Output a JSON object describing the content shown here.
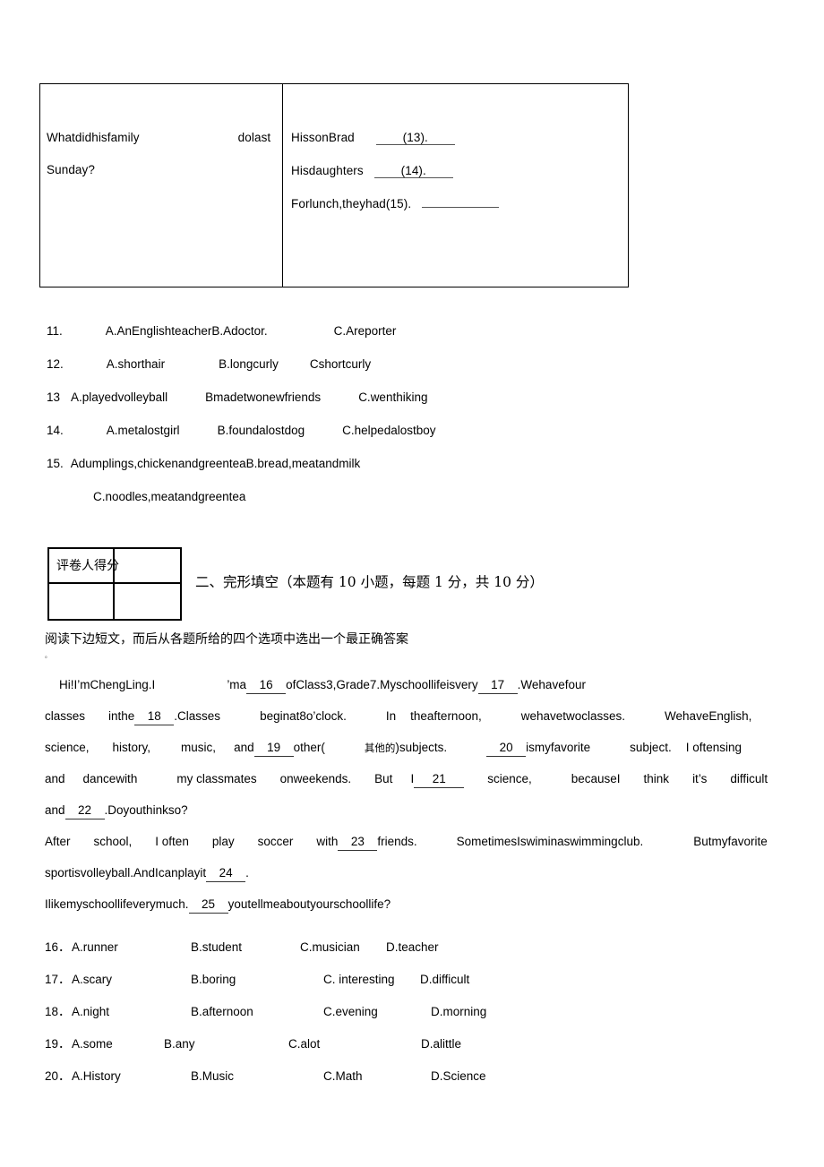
{
  "document": {
    "type": "exam-paper",
    "language": "en-zh"
  },
  "top_table": {
    "left_cell": {
      "line1_a": "Whatdidhisfamily",
      "line1_b": "dolast",
      "line2": "Sunday?"
    },
    "right_cell": {
      "row1_label": "HissonBrad",
      "row1_blank": "(13).",
      "row2_label": "Hisdaughters",
      "row2_blank": "(14).",
      "row3_label": "Forlunch,theyhad(15).",
      "row3_blank": ""
    }
  },
  "choices_a": [
    {
      "num": "11.",
      "a": "A.AnEnglishteacher",
      "b": "B.Adoctor.",
      "c": "C.Areporter",
      "d": ""
    },
    {
      "num": "12.",
      "a": "A.shorthair",
      "b": "B.longcurly",
      "c": "Cshortcurly",
      "d": ""
    },
    {
      "num": "13",
      "a": "A.playedvolleyball",
      "b": "Bmadetwonewfriends",
      "c": "C.wenthiking",
      "d": ""
    },
    {
      "num": "14.",
      "a": "A.metalostgirl",
      "b": "B.foundalostdog",
      "c": "C.helpedalostboy",
      "d": ""
    },
    {
      "num": "15.",
      "a": "Adumplings,chickenandgreentea",
      "b": "B.bread,meatandmilk",
      "c": "C.noodles,meatandgreentea",
      "d": ""
    }
  ],
  "score_box": {
    "label": "评卷人得分"
  },
  "section": {
    "heading": "二、完形填空（本题有 10 小题，每题 1 分，共 10 分）",
    "instruction": "阅读下边短文，而后从各题所给的四个选项中选出一个最正确答案",
    "instruction_period": "。"
  },
  "passage": {
    "line1": {
      "s1": "Hi!I’mChengLing.I",
      "s2": "’ma",
      "blank16": "16",
      "s3": "ofClass3,Grade7.Myschoollifeisvery",
      "blank17": "17",
      "s4": ".Wehavefour"
    },
    "line2": {
      "s1": "classes",
      "s2": "inthe",
      "blank18": "18",
      "s3": ".Classes",
      "s4": "beginat8o’clock.",
      "s5": "In",
      "s6": "theafternoon,",
      "s7": "wehavetwoclasses.",
      "s8": "WehaveEnglish,"
    },
    "line3": {
      "s1": "science,",
      "s2": "history,",
      "s3": "music,",
      "s4": "and",
      "blank19": "19",
      "s5": "other(",
      "note": "其他的",
      "s6": ")subjects.",
      "blank20": "20",
      "s7": "ismyfavorite",
      "s8": "subject.",
      "s9": "I oftensing"
    },
    "line4": {
      "s1": "and",
      "s2": "dancewith",
      "s3": "my classmates",
      "s4": "onweekends.",
      "s5": "But",
      "s6": "I",
      "blank21": "21",
      "s7": "science,",
      "s8": "becauseI",
      "s9": "think",
      "s10": "it’s",
      "s11": "difficult"
    },
    "line5": {
      "s1": "and",
      "blank22": "22",
      "s2": ".Doyouthinkso?"
    },
    "line6": {
      "s1": "After",
      "s2": "school,",
      "s3": "I often",
      "s4": "play",
      "s5": "soccer",
      "s6": "with",
      "blank23": "23",
      "s7": "friends.",
      "s8": "SometimesIswiminaswimmingclub.",
      "s9": "Butmyfavorite"
    },
    "line7": {
      "s1": "sportisvolleyball.AndIcanplayit",
      "blank24": "24",
      "s2": "."
    },
    "line8": {
      "s1": "Ilikemyschoollifeverymuch.",
      "blank25": "25",
      "s2": "youtellmeaboutyourschoollife?"
    }
  },
  "choices_b": [
    {
      "num": "16．",
      "a": "A.runner",
      "b": "B.student",
      "c": "C.musician",
      "d": "D.teacher"
    },
    {
      "num": "17．",
      "a": "A.scary",
      "b": "B.boring",
      "c": "C.  interesting",
      "d": "D.difficult"
    },
    {
      "num": "18．",
      "a": "A.night",
      "b": "B.afternoon",
      "c": "C.evening",
      "d": "D.morning"
    },
    {
      "num": "19．",
      "a": "A.some",
      "b": "B.any",
      "c": "C.alot",
      "d": "D.alittle"
    },
    {
      "num": "20．",
      "a": "A.History",
      "b": "B.Music",
      "c": "C.Math",
      "d": "D.Science"
    }
  ]
}
